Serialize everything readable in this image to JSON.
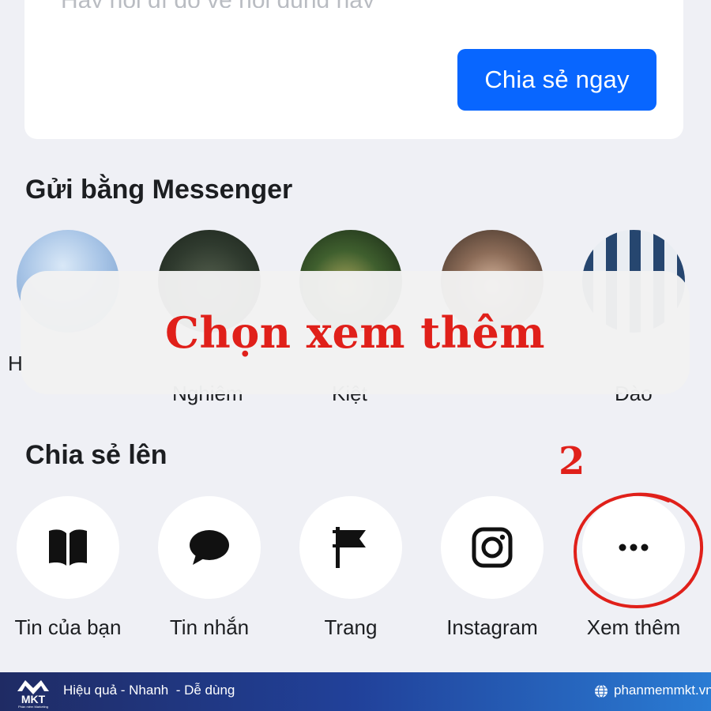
{
  "composer": {
    "placeholder": "Hãy nói gì đó về nội dung này",
    "share_now_label": "Chia sẻ ngay"
  },
  "messenger": {
    "title": "Gửi bằng Messenger",
    "contacts": [
      {
        "name": "H"
      },
      {
        "name": "Nghiêm"
      },
      {
        "name": "Kiệt"
      },
      {
        "name": ""
      },
      {
        "name": "Đào"
      }
    ]
  },
  "overlay": {
    "text": "Chọn xem thêm",
    "step_number": "2",
    "color": "#e0201a"
  },
  "share_to": {
    "title": "Chia sẻ lên",
    "options": [
      {
        "label": "Tin của bạn",
        "icon": "book-open-icon"
      },
      {
        "label": "Tin nhắn",
        "icon": "message-bubble-icon"
      },
      {
        "label": "Trang",
        "icon": "flag-icon"
      },
      {
        "label": "Instagram",
        "icon": "instagram-icon"
      },
      {
        "label": "Xem thêm",
        "icon": "more-dots-icon"
      }
    ]
  },
  "footer": {
    "brand": "MKT",
    "brand_subtitle": "Phần mềm Marketing",
    "tagline": "Hiệu quả - Nhanh  - Dễ dùng",
    "website": "phanmemmkt.vn"
  },
  "colors": {
    "accent": "#0866ff",
    "background": "#eff0f5",
    "highlight": "#e0201a"
  }
}
